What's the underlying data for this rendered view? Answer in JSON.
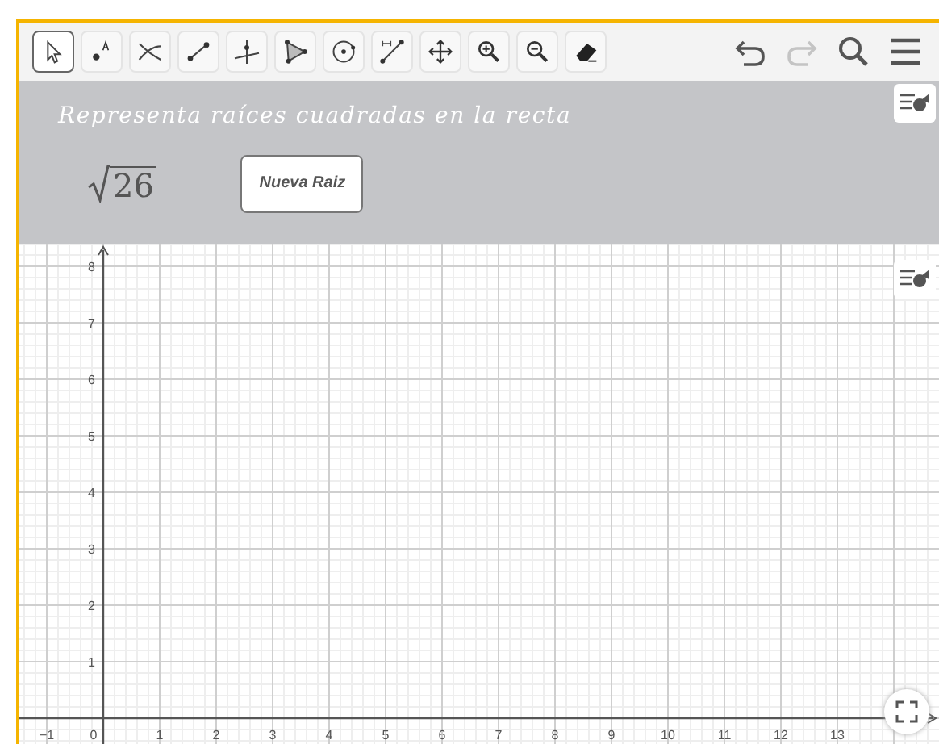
{
  "toolbar": {
    "tools": [
      {
        "kind": "move",
        "selected": true
      },
      {
        "kind": "point",
        "selected": false
      },
      {
        "kind": "intersect",
        "selected": false
      },
      {
        "kind": "segment",
        "selected": false
      },
      {
        "kind": "perpendicular",
        "selected": false
      },
      {
        "kind": "polygon",
        "selected": false
      },
      {
        "kind": "circle",
        "selected": false
      },
      {
        "kind": "distance",
        "selected": false
      },
      {
        "kind": "pan",
        "selected": false
      },
      {
        "kind": "zoomin",
        "selected": false
      },
      {
        "kind": "zoomout",
        "selected": false
      },
      {
        "kind": "eraser",
        "selected": false
      }
    ],
    "actions": [
      {
        "kind": "undo",
        "disabled": false
      },
      {
        "kind": "redo",
        "disabled": true
      },
      {
        "kind": "search",
        "disabled": false
      },
      {
        "kind": "menu",
        "disabled": false
      }
    ]
  },
  "panel": {
    "title": "Representa raíces cuadradas en la recta",
    "radicand": "26",
    "button": "Nueva Raiz"
  },
  "graph": {
    "x_labels": [
      "−1",
      "0",
      "1",
      "2",
      "3",
      "4",
      "5",
      "6",
      "7",
      "8",
      "9",
      "10",
      "11",
      "12",
      "13"
    ],
    "y_labels": [
      "8",
      "7",
      "6",
      "5",
      "4",
      "3",
      "2",
      "1"
    ]
  }
}
